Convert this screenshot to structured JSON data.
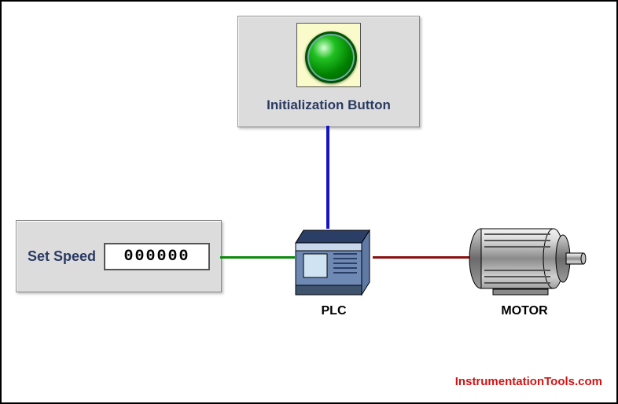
{
  "init_panel": {
    "caption": "Initialization Button",
    "button_state": "green-on"
  },
  "speed_panel": {
    "label": "Set Speed",
    "value": "000000"
  },
  "plc": {
    "label": "PLC"
  },
  "motor": {
    "label": "MOTOR"
  },
  "wires": {
    "init_to_plc": "blue",
    "speed_to_plc": "green",
    "plc_to_motor": "red"
  },
  "watermark": "InstrumentationTools.com"
}
